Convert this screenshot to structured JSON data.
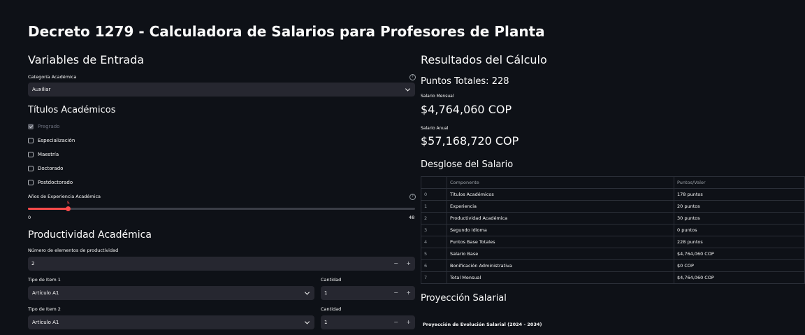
{
  "app": {
    "title": "Decreto 1279 - Calculadora de Salarios para Profesores de Planta"
  },
  "inputs": {
    "heading": "Variables de Entrada",
    "categoria_label": "Categoría Académica",
    "categoria_value": "Auxiliar",
    "titulos_heading": "Títulos Académicos",
    "titulos": [
      {
        "label": "Pregrado",
        "checked": true,
        "disabled": true
      },
      {
        "label": "Especialización",
        "checked": false
      },
      {
        "label": "Maestría",
        "checked": false
      },
      {
        "label": "Doctorado",
        "checked": false
      },
      {
        "label": "Postdoctorado",
        "checked": false
      }
    ],
    "experiencia_label": "Años de Experiencia Académica",
    "experiencia_value": "5",
    "experiencia_min": "0",
    "experiencia_max": "48",
    "experiencia_fraction": 0.1042,
    "productividad_heading": "Productividad Académica",
    "num_elementos_label": "Número de elementos de productividad",
    "num_elementos_value": "2",
    "items": [
      {
        "tipo_label": "Tipo de Item 1",
        "tipo_value": "Artículo A1",
        "cantidad_label": "Cantidad",
        "cantidad_value": "1"
      },
      {
        "tipo_label": "Tipo de Item 2",
        "tipo_value": "Artículo A1",
        "cantidad_label": "Cantidad",
        "cantidad_value": "1"
      }
    ],
    "minus": "−",
    "plus": "+",
    "help": "?"
  },
  "results": {
    "heading": "Resultados del Cálculo",
    "puntos_totales": "Puntos Totales: 228",
    "salario_mensual_label": "Salario Mensual",
    "salario_mensual_value": "$4,764,060 COP",
    "salario_anual_label": "Salario Anual",
    "salario_anual_value": "$57,168,720 COP",
    "desglose_heading": "Desglose del Salario",
    "table": {
      "columns": [
        "",
        "Componente",
        "Puntos/Valor"
      ],
      "rows": [
        [
          "0",
          "Títulos Académicos",
          "178 puntos"
        ],
        [
          "1",
          "Experiencia",
          "20 puntos"
        ],
        [
          "2",
          "Productividad Académica",
          "30 puntos"
        ],
        [
          "3",
          "Segundo Idioma",
          "0 puntos"
        ],
        [
          "4",
          "Puntos Base Totales",
          "228 puntos"
        ],
        [
          "5",
          "Salario Base",
          "$4,764,060 COP"
        ],
        [
          "6",
          "Bonificación Administrativa",
          "$0 COP"
        ],
        [
          "7",
          "Total Mensual",
          "$4,764,060 COP"
        ]
      ]
    },
    "proyeccion_heading": "Proyección Salarial",
    "proyeccion_chart_title": "Proyección de Evolución Salarial (2024 - 2034)"
  },
  "colors": {
    "accent": "#ff4b4b",
    "background": "#0e1117",
    "widget": "#262730"
  }
}
